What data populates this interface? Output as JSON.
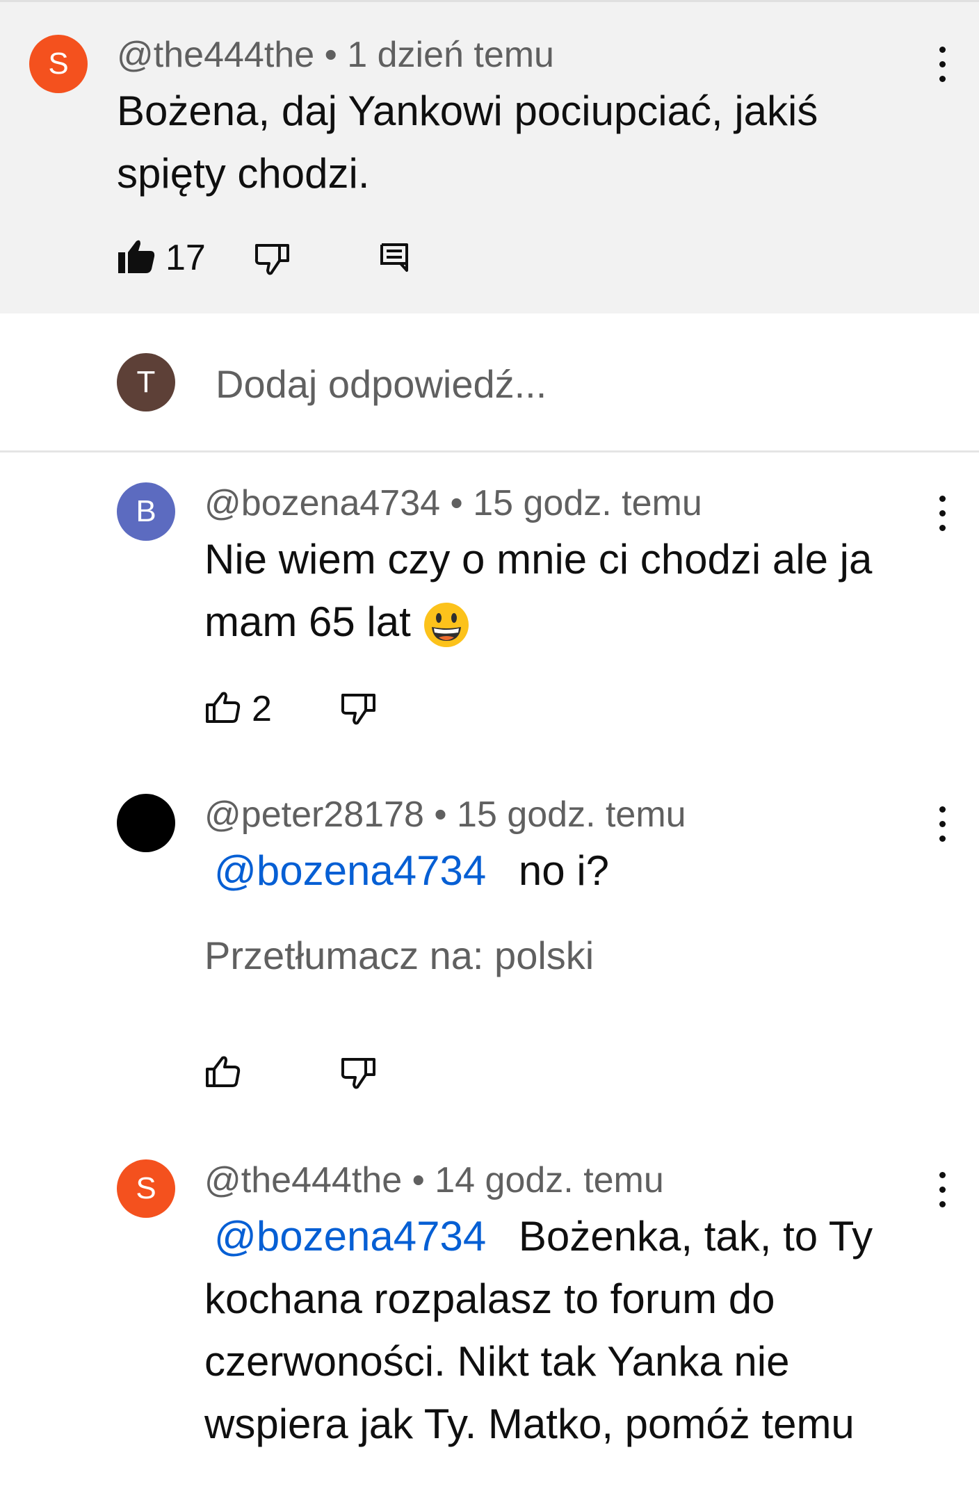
{
  "thread": {
    "parent": {
      "avatar_letter": "S",
      "avatar_color": "#f4511e",
      "author": "@the444the",
      "separator": "•",
      "time": "1 dzień temu",
      "text_line1": "Bożena, daj Yankowi pociupciać, jakiś",
      "text_line2": "spięty chodzi.",
      "likes": "17"
    },
    "reply_box": {
      "avatar_letter": "T",
      "avatar_color": "#5d4037",
      "placeholder": "Dodaj odpowiedź..."
    },
    "replies": [
      {
        "avatar_letter": "B",
        "avatar_color": "#5c6bc0",
        "author": "@bozena4734",
        "separator": "•",
        "time": "15 godz. temu",
        "text_line1": "Nie wiem czy o mnie ci chodzi ale ja",
        "text_line2": "mam 65 lat",
        "emoji": "grinning-face",
        "likes": "2"
      },
      {
        "avatar_letter": "",
        "avatar_color": "#000000",
        "author": "@peter28178",
        "separator": "•",
        "time": "15 godz. temu",
        "mention": "@bozena4734",
        "text": "no i?",
        "translate": "Przetłumacz na: polski",
        "likes": ""
      },
      {
        "avatar_letter": "S",
        "avatar_color": "#f4511e",
        "author": "@the444the",
        "separator": "•",
        "time": "14 godz. temu",
        "mention": "@bozena4734",
        "text_line1": "Bożenka, tak, to Ty",
        "text_line2": "kochana rozpalasz to forum do",
        "text_line3": "czerwoności. Nikt tak Yanka nie",
        "text_line4": "wspiera jak Ty. Matko, pomóż temu"
      }
    ]
  },
  "icons": {
    "like_filled": "thumb-up-filled-icon",
    "like": "thumb-up-outline-icon",
    "dislike": "thumb-down-outline-icon",
    "reply": "comment-icon",
    "menu": "more-vertical-icon"
  },
  "colors": {
    "mention": "#065fd4",
    "meta": "#606060",
    "parent_bg": "#f2f2f2"
  }
}
